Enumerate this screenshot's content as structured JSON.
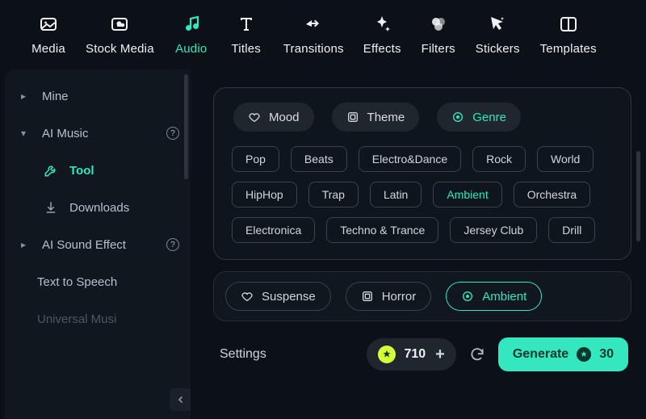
{
  "topbar": [
    {
      "key": "media",
      "label": "Media"
    },
    {
      "key": "stock",
      "label": "Stock Media"
    },
    {
      "key": "audio",
      "label": "Audio"
    },
    {
      "key": "titles",
      "label": "Titles"
    },
    {
      "key": "transitions",
      "label": "Transitions"
    },
    {
      "key": "effects",
      "label": "Effects"
    },
    {
      "key": "filters",
      "label": "Filters"
    },
    {
      "key": "stickers",
      "label": "Stickers"
    },
    {
      "key": "templates",
      "label": "Templates"
    }
  ],
  "topbar_active": "audio",
  "sidebar": {
    "sections": [
      {
        "key": "mine",
        "label": "Mine",
        "expanded": false,
        "help": false
      },
      {
        "key": "aimusic",
        "label": "AI Music",
        "expanded": true,
        "help": true,
        "children": [
          {
            "key": "tool",
            "label": "Tool",
            "icon": "wrench"
          },
          {
            "key": "downloads",
            "label": "Downloads",
            "icon": "download"
          }
        ],
        "active_child": "tool"
      },
      {
        "key": "aisfx",
        "label": "AI Sound Effect",
        "expanded": false,
        "help": true
      },
      {
        "key": "tts",
        "label": "Text to Speech",
        "expanded": null,
        "help": false
      },
      {
        "key": "um",
        "label": "Universal Musi",
        "expanded": null,
        "help": false,
        "faded": true
      }
    ]
  },
  "filters": {
    "tabs": [
      {
        "key": "mood",
        "label": "Mood",
        "icon": "heart"
      },
      {
        "key": "theme",
        "label": "Theme",
        "icon": "frame"
      },
      {
        "key": "genre",
        "label": "Genre",
        "icon": "disc"
      }
    ],
    "active": "genre"
  },
  "genre_tags": [
    "Pop",
    "Beats",
    "Electro&Dance",
    "Rock",
    "World",
    "HipHop",
    "Trap",
    "Latin",
    "Ambient",
    "Orchestra",
    "Electronica",
    "Techno & Trance",
    "Jersey Club",
    "Drill"
  ],
  "genre_selected": "Ambient",
  "selected_chips": [
    {
      "key": "suspense",
      "label": "Suspense",
      "icon": "heart"
    },
    {
      "key": "horror",
      "label": "Horror",
      "icon": "frame"
    },
    {
      "key": "ambient",
      "label": "Ambient",
      "icon": "disc",
      "active": true
    }
  ],
  "footer": {
    "settings_label": "Settings",
    "credits": "710",
    "generate_label": "Generate",
    "generate_cost": "30"
  }
}
